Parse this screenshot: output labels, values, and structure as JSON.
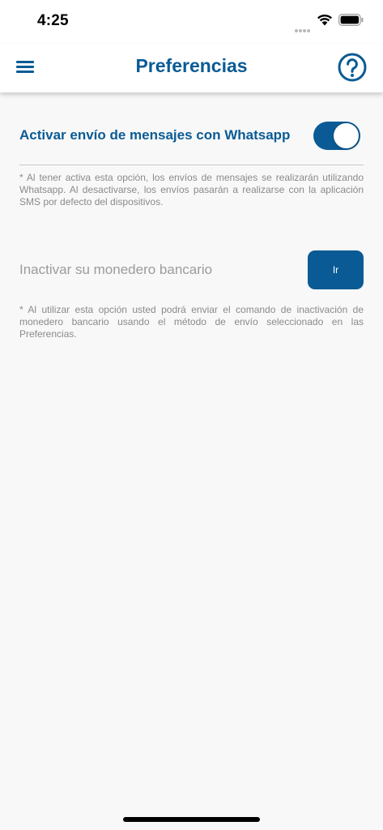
{
  "status_bar": {
    "time": "4:25",
    "icons": [
      "signal-dots-icon",
      "wifi-icon",
      "battery-icon"
    ]
  },
  "header": {
    "title": "Preferencias",
    "menu_icon": "hamburger-menu-icon",
    "help_icon": "help-circle-icon"
  },
  "preferences": {
    "whatsapp": {
      "label": "Activar envío de mensajes con Whatsapp",
      "enabled": true,
      "note": "* Al tener activa esta opción, los envíos de mensajes se realizarán utilizando Whatsapp. Al desactivarse, los envíos pasarán a realizarse con la aplicación SMS por defecto del dispositivos."
    },
    "wallet": {
      "label": "Inactivar su monedero bancario",
      "button_label": "Ir",
      "note": "* Al utilizar esta opción usted podrá enviar el comando de inactivación de monedero bancario usando el método de envío seleccionado en las Preferencias."
    }
  },
  "colors": {
    "primary": "#0a5b95",
    "background": "#f8f8f8",
    "muted_text": "#8a8a8a"
  }
}
